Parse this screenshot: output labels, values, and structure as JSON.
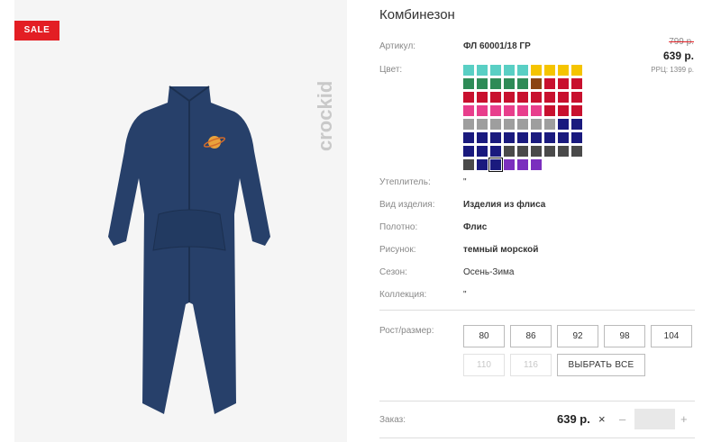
{
  "product": {
    "sale_badge": "SALE",
    "brand": "crockid",
    "title": "Комбинезон"
  },
  "price": {
    "old": "799 р.",
    "new": "639 р.",
    "rrp": "РРЦ: 1399 р."
  },
  "attributes": {
    "article_label": "Артикул:",
    "article_value": "ФЛ 60001/18 ГР",
    "color_label": "Цвет:",
    "insulation_label": "Утеплитель:",
    "insulation_value": "\"",
    "item_type_label": "Вид изделия:",
    "item_type_value": "Изделия из флиса",
    "fabric_label": "Полотно:",
    "fabric_value": "Флис",
    "pattern_label": "Рисунок:",
    "pattern_value": "темный морской",
    "season_label": "Сезон:",
    "season_value": "Осень-Зима",
    "collection_label": "Коллекция:",
    "collection_value": "\""
  },
  "swatches": [
    "#59cfc4",
    "#59cfc4",
    "#59cfc4",
    "#59cfc4",
    "#59cfc4",
    "#f5c400",
    "#f5c400",
    "#f5c400",
    "#f5c400",
    "#2e8b57",
    "#2e8b57",
    "#2e8b57",
    "#2e8b57",
    "#2e8b57",
    "#8b4513",
    "#c8102e",
    "#c8102e",
    "#c8102e",
    "#c8102e",
    "#c8102e",
    "#c8102e",
    "#c8102e",
    "#c8102e",
    "#c8102e",
    "#c8102e",
    "#c8102e",
    "#c8102e",
    "#e83e8c",
    "#e83e8c",
    "#e83e8c",
    "#e83e8c",
    "#e83e8c",
    "#e83e8c",
    "#c8102e",
    "#c8102e",
    "#c8102e",
    "#9e9e9e",
    "#9e9e9e",
    "#9e9e9e",
    "#9e9e9e",
    "#9e9e9e",
    "#9e9e9e",
    "#9e9e9e",
    "#1a1a7e",
    "#1a1a7e",
    "#1a1a7e",
    "#1a1a7e",
    "#1a1a7e",
    "#1a1a7e",
    "#1a1a7e",
    "#1a1a7e",
    "#1a1a7e",
    "#1a1a7e",
    "#1a1a7e",
    "#1a1a7e",
    "#1a1a7e",
    "#1a1a7e",
    "#4a4a4a",
    "#4a4a4a",
    "#4a4a4a",
    "#4a4a4a",
    "#4a4a4a",
    "#4a4a4a",
    "#4a4a4a",
    "#1a1a7e",
    "#1a1a7e",
    "#7b2fbe",
    "#7b2fbe",
    "#7b2fbe"
  ],
  "selected_swatch_index": 65,
  "sizes": {
    "label": "Рост/размер:",
    "options": [
      "80",
      "86",
      "92",
      "98",
      "104",
      "110",
      "116"
    ],
    "disabled_from_index": 5,
    "select_all": "ВЫБРАТЬ ВСЕ"
  },
  "order": {
    "label": "Заказ:",
    "price": "639 р.",
    "remove": "×",
    "minus": "–",
    "plus": "+",
    "quantity": ""
  }
}
